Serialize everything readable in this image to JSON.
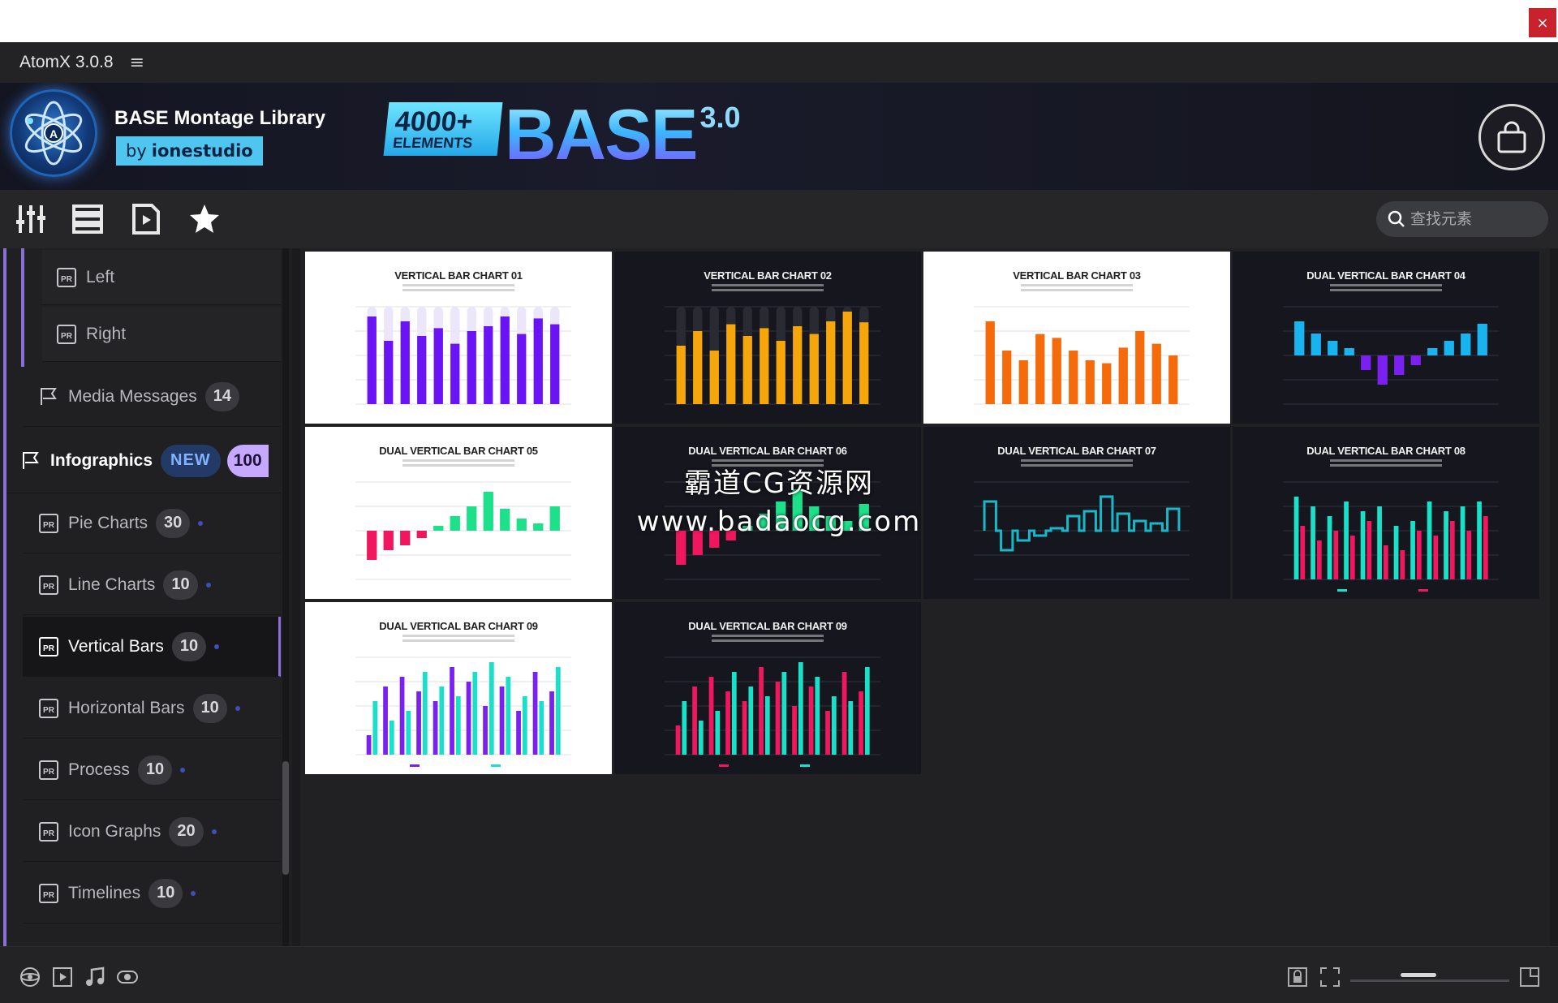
{
  "window": {
    "close_label": "×"
  },
  "app": {
    "title": "AtomX 3.0.8",
    "menu_icon": "hamburger-menu-icon"
  },
  "banner": {
    "library_title": "BASE Montage Library",
    "by_prefix": "by",
    "author": "ionestudio",
    "hero_count": "4000+",
    "hero_elements": "ELEMENTS",
    "hero_word": "BASE",
    "hero_version": "3.0"
  },
  "toolbar": {
    "tools": [
      "mixer-sliders-icon",
      "list-view-icon",
      "media-play-icon",
      "favorites-star-icon"
    ],
    "search_placeholder": "查找元素"
  },
  "sidebar": {
    "sub_items": [
      {
        "label": "Left"
      },
      {
        "label": "Right"
      }
    ],
    "media_messages": {
      "label": "Media Messages",
      "count": "14"
    },
    "category": {
      "label": "Infographics",
      "new_badge": "NEW",
      "count": "100"
    },
    "items": [
      {
        "label": "Pie Charts",
        "count": "30"
      },
      {
        "label": "Line Charts",
        "count": "10"
      },
      {
        "label": "Vertical Bars",
        "count": "10",
        "active": true
      },
      {
        "label": "Horizontal Bars",
        "count": "10"
      },
      {
        "label": "Process",
        "count": "10"
      },
      {
        "label": "Icon Graphs",
        "count": "20"
      },
      {
        "label": "Timelines",
        "count": "10"
      }
    ]
  },
  "thumbnails": [
    {
      "title": "VERTICAL BAR CHART 01",
      "theme": "light",
      "kind": "single",
      "color": "#6a14f5",
      "track": "#ece6fb",
      "values": [
        0.9,
        0.65,
        0.85,
        0.7,
        0.78,
        0.62,
        0.75,
        0.8,
        0.9,
        0.72,
        0.88,
        0.82
      ]
    },
    {
      "title": "VERTICAL BAR CHART 02",
      "theme": "dark",
      "kind": "single",
      "color": "#f5a60a",
      "track": "#2a2a33",
      "values": [
        0.6,
        0.75,
        0.55,
        0.82,
        0.7,
        0.78,
        0.65,
        0.8,
        0.72,
        0.85,
        0.95,
        0.84
      ]
    },
    {
      "title": "VERTICAL BAR CHART 03",
      "theme": "light",
      "kind": "single",
      "color": "#f56a0a",
      "track": "",
      "values": [
        0.85,
        0.55,
        0.45,
        0.72,
        0.68,
        0.55,
        0.45,
        0.42,
        0.58,
        0.75,
        0.62,
        0.5
      ]
    },
    {
      "title": "DUAL VERTICAL BAR CHART 04",
      "theme": "dark",
      "kind": "dual",
      "color": "#19b4f0",
      "neg_color": "#7a20f0",
      "values": [
        0.7,
        0.45,
        0.3,
        0.15,
        -0.3,
        -0.6,
        -0.4,
        -0.2,
        0.15,
        0.3,
        0.45,
        0.65
      ]
    },
    {
      "title": "DUAL VERTICAL BAR CHART 05",
      "theme": "light",
      "kind": "dual",
      "color": "#1ee08a",
      "neg_color": "#f0175f",
      "values": [
        -0.6,
        -0.4,
        -0.3,
        -0.15,
        0.1,
        0.3,
        0.5,
        0.8,
        0.45,
        0.25,
        0.15,
        0.5
      ]
    },
    {
      "title": "DUAL VERTICAL BAR CHART 06",
      "theme": "dark",
      "kind": "dual",
      "color": "#1ee08a",
      "neg_color": "#f0175f",
      "values": [
        -0.7,
        -0.5,
        -0.35,
        -0.2,
        0.1,
        0.35,
        0.6,
        0.85,
        0.5,
        0.3,
        0.2,
        0.55
      ]
    },
    {
      "title": "DUAL VERTICAL BAR CHART 07",
      "theme": "dark",
      "kind": "step",
      "color": "#19b8c8",
      "values": [
        0.6,
        -0.4,
        -0.2,
        -0.1,
        0.05,
        0.3,
        0.4,
        0.7,
        0.35,
        0.2,
        0.15,
        0.45
      ]
    },
    {
      "title": "DUAL VERTICAL BAR CHART 08",
      "theme": "dark",
      "kind": "pair",
      "color": "#19e0c8",
      "color2": "#f0175f",
      "values": [
        0.85,
        0.55,
        0.75,
        0.4,
        0.65,
        0.5,
        0.8,
        0.45,
        0.7,
        0.6,
        0.75,
        0.35,
        0.55,
        0.3,
        0.6,
        0.5,
        0.8,
        0.45,
        0.7,
        0.6,
        0.75,
        0.5,
        0.8,
        0.65
      ]
    },
    {
      "title": "DUAL VERTICAL BAR CHART 09",
      "theme": "light",
      "kind": "pair",
      "color": "#7a20f0",
      "color2": "#19e0c8",
      "values": [
        0.2,
        0.55,
        0.7,
        0.35,
        0.8,
        0.45,
        0.65,
        0.85,
        0.55,
        0.7,
        0.9,
        0.6,
        0.75,
        0.85,
        0.5,
        0.95,
        0.7,
        0.8,
        0.45,
        0.6,
        0.85,
        0.55,
        0.65,
        0.9
      ]
    },
    {
      "title": "DUAL VERTICAL BAR CHART 09",
      "theme": "dark",
      "kind": "pair",
      "color": "#f0175f",
      "color2": "#19e0c8",
      "values": [
        0.3,
        0.55,
        0.7,
        0.35,
        0.8,
        0.45,
        0.65,
        0.85,
        0.55,
        0.7,
        0.9,
        0.6,
        0.75,
        0.85,
        0.5,
        0.95,
        0.7,
        0.8,
        0.45,
        0.6,
        0.85,
        0.55,
        0.65,
        0.9
      ]
    }
  ],
  "watermark": {
    "line1": "霸道CG资源网",
    "line2": "www.badaocg.com"
  },
  "bottom_bar": {
    "left_icons": [
      "3d-object-icon",
      "video-clip-icon",
      "music-note-icon",
      "preview-eye-icon"
    ],
    "right_icons": [
      "lock-icon",
      "fit-frame-icon",
      "expand-icon"
    ],
    "zoom_level": 0.37
  }
}
